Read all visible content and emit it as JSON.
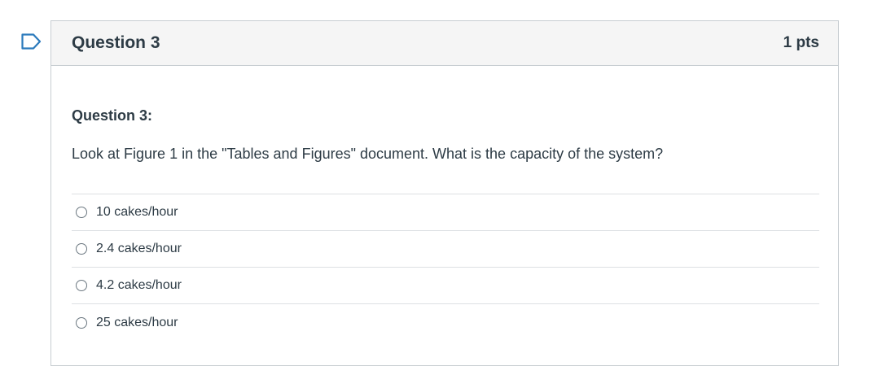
{
  "colors": {
    "flag_outline": "#2b7abc",
    "text": "#2d3b45",
    "header_bg": "#f5f5f5",
    "border": "#c7cdd1"
  },
  "question": {
    "title": "Question 3",
    "points": "1 pts",
    "flag_icon": "flag-outline-icon",
    "subheading": "Question 3:",
    "text": "Look at Figure 1 in the \"Tables and Figures\" document. What is the capacity of the system?",
    "answers": [
      {
        "label": "10 cakes/hour",
        "selected": false
      },
      {
        "label": "2.4 cakes/hour",
        "selected": false
      },
      {
        "label": "4.2 cakes/hour",
        "selected": false
      },
      {
        "label": "25 cakes/hour",
        "selected": false
      }
    ]
  }
}
